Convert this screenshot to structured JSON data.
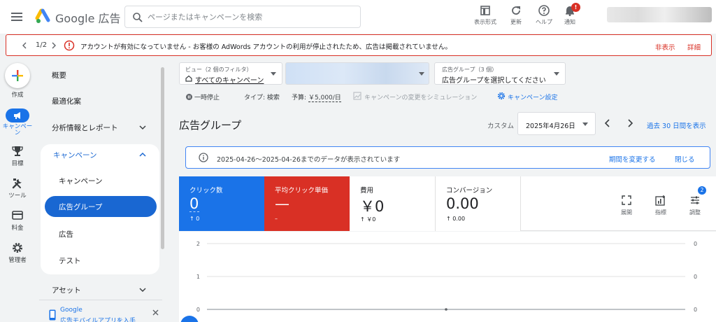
{
  "header": {
    "brand": "Google 広告",
    "search_placeholder": "ページまたはキャンペーンを検索",
    "tools": [
      {
        "label": "表示形式",
        "icon": "appearance-icon"
      },
      {
        "label": "更新",
        "icon": "refresh-icon"
      },
      {
        "label": "ヘルプ",
        "icon": "help-icon"
      },
      {
        "label": "通知",
        "icon": "bell-icon"
      }
    ],
    "notification_count": "!"
  },
  "alert": {
    "pager": "1/2",
    "message": "アカウントが有効になっていません - お客様の AdWords アカウントの利用が停止されたため、広告は掲載されていません。",
    "hide": "非表示",
    "details": "詳細"
  },
  "rail": {
    "create": "作成",
    "items": [
      {
        "label": "キャンペー\nン",
        "icon": "megaphone-icon",
        "active": true
      },
      {
        "label": "目標",
        "icon": "trophy-icon"
      },
      {
        "label": "ツール",
        "icon": "tools-icon"
      },
      {
        "label": "料金",
        "icon": "billing-icon"
      },
      {
        "label": "管理者",
        "icon": "gear-icon"
      }
    ]
  },
  "nav": {
    "overview": "概要",
    "recommendations": "最適化案",
    "insights": "分析情報とレポート",
    "campaigns_section": "キャンペーン",
    "sub_items": [
      "キャンペーン",
      "広告グループ",
      "広告",
      "テスト"
    ],
    "selected": "広告グループ",
    "assets": "アセット",
    "promo_title": "Google",
    "promo_text": "広告モバイルアプリを入手"
  },
  "filters": {
    "view_label": "ビュー（2 個のフィルタ）",
    "view_value": "すべてのキャンペーン",
    "adgroup_label": "広告グループ（3 個）",
    "adgroup_value": "広告グループを選択してください"
  },
  "info_row": {
    "status": "一時停止",
    "type": "タイプ: 検索",
    "budget_label": "予算:",
    "budget_value": "￥5,000/日",
    "simulate": "キャンペーンの変更をシミュレーション",
    "settings": "キャンペーン設定"
  },
  "page": {
    "title": "広告グループ",
    "date_mode": "カスタム",
    "date_value": "2025年4月26日",
    "past_link": "過去 30 日間を表示"
  },
  "banner": {
    "text": "2025-04-26〜2025-04-26までのデータが表示されています",
    "change_period": "期間を変更する",
    "close": "閉じる"
  },
  "metrics": {
    "cards": [
      {
        "label": "クリック数",
        "value": "0",
        "sub": "↑ 0",
        "bg": "#1a73e8",
        "fg": "#ffffff"
      },
      {
        "label": "平均クリック単価",
        "value": "—",
        "sub": "–",
        "bg": "#d93025",
        "fg": "#ffffff"
      },
      {
        "label": "費用",
        "value": "￥0",
        "sub": "↑ ￥0",
        "bg": "#ffffff",
        "fg": "#202124"
      },
      {
        "label": "コンバージョン",
        "value": "0.00",
        "sub": "↑ 0.00",
        "bg": "#ffffff",
        "fg": "#202124"
      }
    ],
    "tools": [
      {
        "label": "展開",
        "icon": "expand-icon"
      },
      {
        "label": "指標",
        "icon": "metrics-icon"
      },
      {
        "label": "調整",
        "icon": "tune-icon",
        "badge": "2"
      }
    ]
  },
  "chart_data": {
    "type": "line",
    "y_left_ticks": [
      "2",
      "1",
      "0"
    ],
    "y_right_ticks": [
      "0",
      "0",
      "0"
    ],
    "ylim": [
      0,
      2
    ],
    "series": [
      {
        "values": [
          0
        ]
      }
    ],
    "grid": true
  }
}
